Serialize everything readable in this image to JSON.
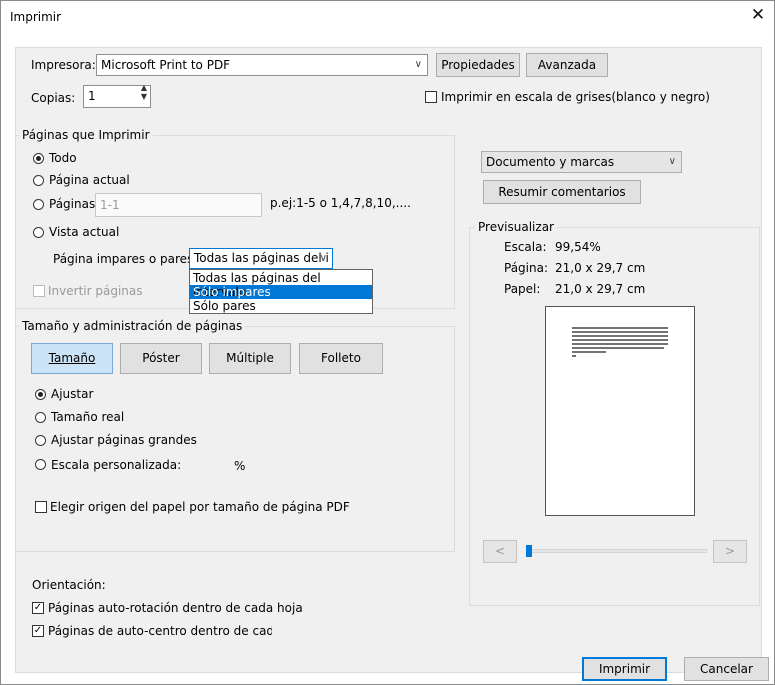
{
  "window": {
    "title": "Imprimir",
    "close_glyph": "✕"
  },
  "printer": {
    "label": "Impresora:",
    "selected": "Microsoft Print to PDF",
    "properties_button": "Propiedades",
    "advanced_button": "Avanzada",
    "copies_label": "Copias:",
    "copies_value": "1",
    "grayscale_label": "Imprimir en escala de grises(blanco y negro)",
    "grayscale_checked": false
  },
  "pages": {
    "legend": "Páginas que Imprimir",
    "radio_all": "Todo",
    "radio_current": "Página actual",
    "radio_pages": "Páginas",
    "pages_placeholder": "1-1",
    "pages_hint": "p.ej:1-5 o 1,4,7,8,10,....",
    "radio_view": "Vista actual",
    "selected": "Todo",
    "odd_even_label": "Página impares o pares:",
    "odd_even_selected": "Todas las páginas del i",
    "odd_even_options": [
      "Todas las páginas del intervalo",
      "Sólo impares",
      "Sólo pares"
    ],
    "highlighted_option": "Sólo impares",
    "reverse_label": "Invertir páginas",
    "reverse_enabled": false
  },
  "sizing": {
    "legend": "Tamaño y administración de páginas",
    "tabs": [
      "Tamaño",
      "Póster",
      "Múltiple",
      "Folleto"
    ],
    "active_tab": "Tamaño",
    "radio_fit": "Ajustar",
    "radio_actual": "Tamaño real",
    "radio_shrink": "Ajustar páginas grandes",
    "radio_custom": "Escala personalizada:",
    "custom_unit": "%",
    "selected": "Ajustar",
    "paper_source_label": "Elegir origen del papel por tamaño de página PDF",
    "paper_source_checked": false
  },
  "orientation": {
    "label": "Orientación:",
    "auto_rotate": "Páginas auto-rotación dentro de cada hoja",
    "auto_center": "Páginas de auto-centro dentro de cada h",
    "auto_rotate_checked": true,
    "auto_center_checked": true
  },
  "comments": {
    "selected": "Documento y marcas",
    "summarize_button": "Resumir comentarios"
  },
  "preview": {
    "legend": "Previsualizar",
    "scale_label": "Escala:",
    "scale_value": "99,54%",
    "page_label": "Página:",
    "page_value": "21,0 x 29,7 cm",
    "paper_label": "Papel:",
    "paper_value": "21,0 x 29,7 cm",
    "prev_glyph": "<",
    "next_glyph": ">"
  },
  "actions": {
    "print_button": "Imprimir",
    "cancel_button": "Cancelar"
  },
  "colors": {
    "accent": "#0078d7",
    "panel_bg": "#f0f0f0",
    "active_tab_bg": "#cce4f7"
  }
}
